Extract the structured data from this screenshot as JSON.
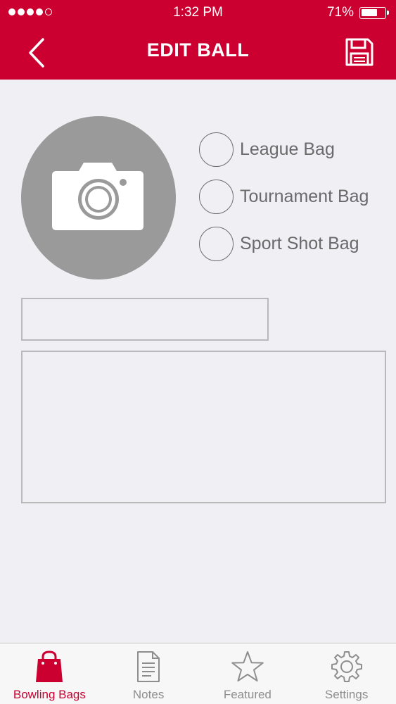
{
  "status_bar": {
    "signal_bars_filled": 4,
    "signal_bars_total": 5,
    "time": "1:32 PM",
    "battery_percent_text": "71%",
    "battery_level": 0.71
  },
  "nav": {
    "title": "EDIT BALL",
    "back_icon": "chevron-left-icon",
    "save_icon": "floppy-disk-icon"
  },
  "photo": {
    "icon": "camera-icon"
  },
  "bag_options": [
    {
      "label": "League Bag",
      "selected": false
    },
    {
      "label": "Tournament Bag",
      "selected": false
    },
    {
      "label": "Sport Shot Bag",
      "selected": false
    }
  ],
  "form": {
    "name_value": "",
    "name_placeholder": "",
    "notes_value": "",
    "notes_placeholder": ""
  },
  "tabs": [
    {
      "label": "Bowling Bags",
      "icon": "shopping-bag-icon",
      "active": true
    },
    {
      "label": "Notes",
      "icon": "document-icon",
      "active": false
    },
    {
      "label": "Featured",
      "icon": "star-icon",
      "active": false
    },
    {
      "label": "Settings",
      "icon": "gear-icon",
      "active": false
    }
  ],
  "colors": {
    "brand_red": "#cc0030",
    "background": "#efeff4",
    "inactive_gray": "#8e8e8e"
  }
}
